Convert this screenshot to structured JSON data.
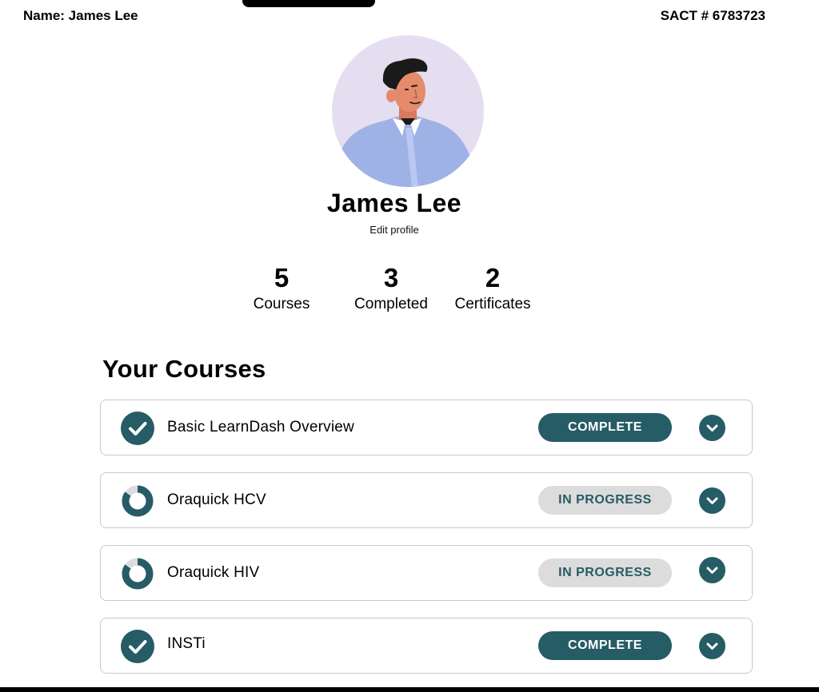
{
  "header": {
    "name_label": "Name: James Lee",
    "sact_label": "SACT # 6783723"
  },
  "profile": {
    "avatar_icon": "avatar-illustration",
    "name": "James Lee",
    "edit_label": "Edit profile"
  },
  "stats": [
    {
      "value": "5",
      "label": "Courses"
    },
    {
      "value": "3",
      "label": "Completed"
    },
    {
      "value": "2",
      "label": "Certificates"
    }
  ],
  "courses_section": {
    "title": "Your Courses",
    "items": [
      {
        "title": "Basic LearnDash Overview",
        "status": "COMPLETE",
        "state": "complete",
        "progress": 1.0
      },
      {
        "title": "Oraquick HCV",
        "status": "IN PROGRESS",
        "state": "in-progress",
        "progress": 0.85
      },
      {
        "title": "Oraquick HIV",
        "status": "IN PROGRESS",
        "state": "in-progress",
        "progress": 0.85
      },
      {
        "title": "INSTi",
        "status": "COMPLETE",
        "state": "complete",
        "progress": 1.0
      }
    ]
  },
  "colors": {
    "accent": "#265c66",
    "badge_progress_bg": "#dcdcdc",
    "avatar_bg": "#e4def0"
  }
}
